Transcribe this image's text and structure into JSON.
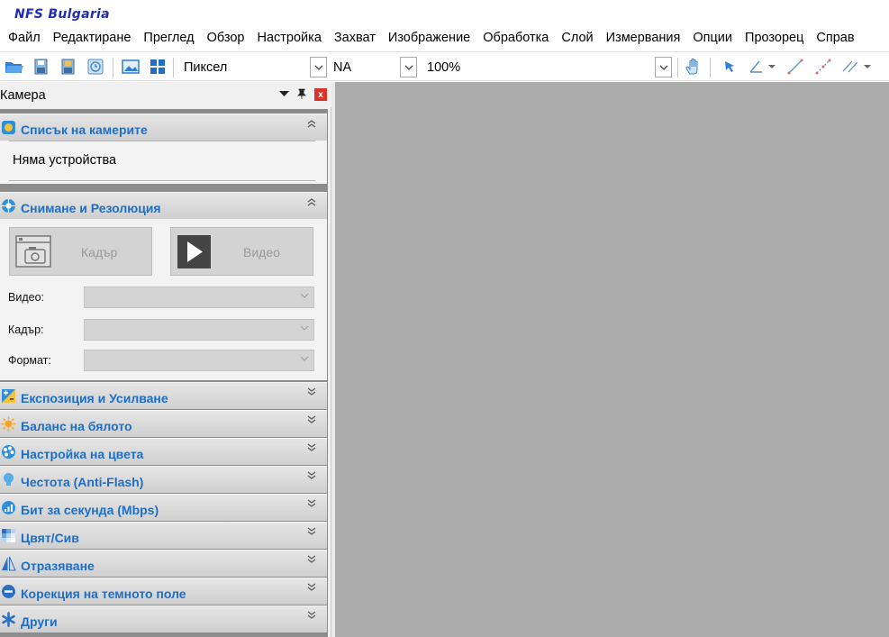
{
  "app": {
    "title": "NFS Bulgaria"
  },
  "menu": [
    "Файл",
    "Редактиране",
    "Преглед",
    "Обзор",
    "Настройка",
    "Захват",
    "Изображение",
    "Обработка",
    "Слой",
    "Измервания",
    "Опции",
    "Прозорец",
    "Справ"
  ],
  "toolbar": {
    "unit_select": "Пиксел",
    "na_select": "NA",
    "zoom_select": "100%",
    "icons": [
      "open-folder-icon",
      "save-icon",
      "save-as-icon",
      "timer-icon",
      "image-browse-icon",
      "grid-view-icon",
      "hand-pan-icon",
      "pointer-arrow-icon",
      "angle-icon",
      "line-icon",
      "dotted-line-icon",
      "parallel-lines-icon"
    ]
  },
  "dock": {
    "title": "Камера",
    "sections": {
      "camera_list": {
        "title": "Списък на камерите",
        "no_devices": "Няма устройства"
      },
      "capture": {
        "title": "Снимане и Резолюция",
        "snap_label": "Кадър",
        "video_label": "Видео",
        "fields": [
          {
            "label": "Видео:",
            "value": ""
          },
          {
            "label": "Кадър:",
            "value": ""
          },
          {
            "label": "Формат:",
            "value": ""
          }
        ]
      },
      "collapsed": [
        "Експозиция и Усилване",
        "Баланс на бялото",
        "Настройка на цвета",
        "Честота (Anti-Flash)",
        "Бит за секунда (Mbps)",
        "Цвят/Сив",
        "Отразяване",
        "Корекция на темното поле",
        "Други"
      ]
    }
  },
  "colors": {
    "section_title": "#1c6fc4",
    "app_title": "#1f2fb0",
    "canvas": "#ababab",
    "close_button": "#d9342b"
  }
}
